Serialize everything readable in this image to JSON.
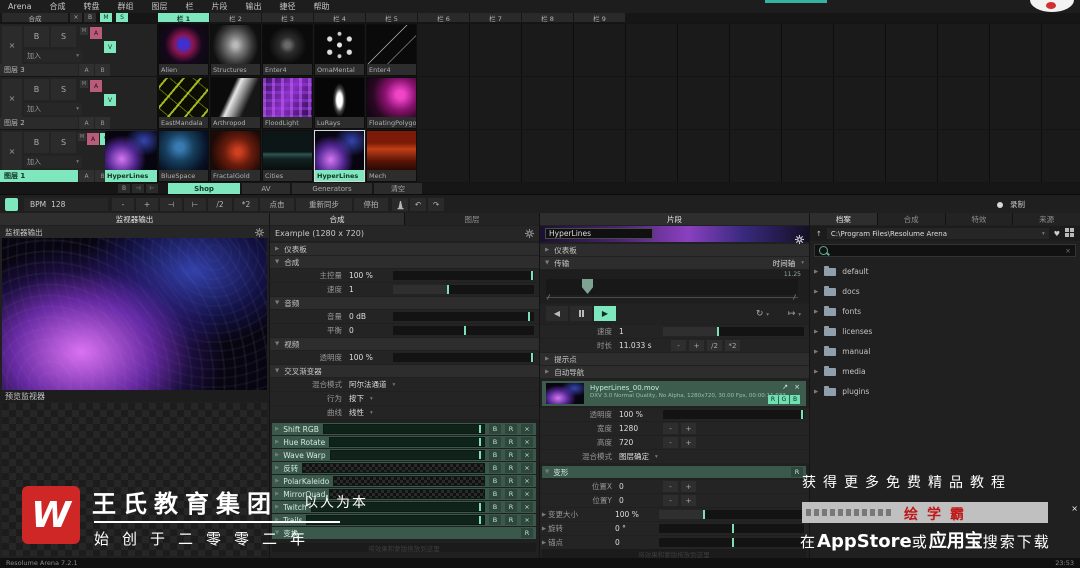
{
  "menu": [
    "Arena",
    "合成",
    "转盘",
    "群组",
    "图层",
    "栏",
    "片段",
    "输出",
    "捷径",
    "帮助"
  ],
  "glyphs": {
    "close": "×",
    "b": "B",
    "s": "S",
    "m": "M",
    "a": "A",
    "v": "V",
    "r": "R",
    "x_label": "X",
    "join": "加入",
    "caret": "▾",
    "tri_right": "▶",
    "tri_down": "▼",
    "minus": "-",
    "plus": "+",
    "half": "/2",
    "double": "*2",
    "rev": "◀",
    "play": "▶",
    "loop": "↻",
    "direction": "↦",
    "nudge_l": "⊣",
    "nudge_r": "⊢",
    "undo": "↶",
    "redo": "↷",
    "heart": "♥",
    "up": "↑",
    "expand": "↗"
  },
  "grid": {
    "comp_label": "合成",
    "columns": [
      "栏 1",
      "栏 2",
      "栏 3",
      "栏 4",
      "栏 5",
      "栏 6",
      "栏 7",
      "栏 8",
      "栏 9"
    ],
    "join_label": "加入",
    "layers": [
      {
        "name": "图层 3"
      },
      {
        "name": "图层 2"
      },
      {
        "name": "图层 1",
        "active_clip": "HyperLines"
      }
    ],
    "rows": [
      {
        "clips": [
          "Alien",
          "Structures",
          "Enter4",
          "OrnaMental",
          "Enter4"
        ]
      },
      {
        "clips": [
          "EastMandala",
          "Arthropod",
          "FloodLight",
          "LuRays",
          "FloatingPolygons"
        ]
      },
      {
        "clips": [
          "BlueSpace",
          "FractalGold",
          "Cities",
          "HyperLines",
          "Mech"
        ]
      }
    ]
  },
  "deck": {
    "tabs": [
      "Shop",
      "AV",
      "Generators",
      "清空"
    ]
  },
  "toolbar": {
    "bpm_label": "BPM",
    "bpm_value": "128",
    "tap": "点击",
    "resync": "重新同步",
    "pause": "停拍",
    "record": "录制"
  },
  "monitor": {
    "tab": "监视器输出",
    "title": "监视器输出",
    "preview_label": "预览监视器"
  },
  "comp_panel": {
    "tabs": [
      "合成",
      "图层"
    ],
    "title": "Example (1280 x 720)",
    "dashboard": "仪表板",
    "composition": "合成",
    "audio": "音频",
    "video": "视频",
    "crossfader": "交叉渐变器",
    "master": {
      "label": "主控量",
      "value": "100 %"
    },
    "speed": {
      "label": "速度",
      "value": "1"
    },
    "volume": {
      "label": "音量",
      "value": "0 dB"
    },
    "pan": {
      "label": "平衡",
      "value": "0"
    },
    "opacity": {
      "label": "透明度",
      "value": "100 %"
    },
    "blend": {
      "label": "混合模式",
      "value": "阿尔法通道"
    },
    "behaviour": {
      "label": "行为",
      "value": "按下"
    },
    "curve": {
      "label": "曲线",
      "value": "线性"
    },
    "hint": "将效果和蒙版拖放到这里"
  },
  "effects": {
    "list": [
      {
        "name": "Shift RGB"
      },
      {
        "name": "Hue Rotate"
      },
      {
        "name": "Wave Warp"
      },
      {
        "name": "反转"
      },
      {
        "name": "PolarKaleido"
      },
      {
        "name": "MirrorQuad"
      },
      {
        "name": "Twitch"
      },
      {
        "name": "Trails"
      },
      {
        "name": "变换"
      }
    ]
  },
  "clip_panel": {
    "tab": "片段",
    "name": "HyperLines",
    "dashboard": "仪表板",
    "transport": "传输",
    "transport_mode": "时间轴",
    "timeline_value": "11.25",
    "speed": {
      "label": "速度",
      "value": "1"
    },
    "duration": {
      "label": "时长",
      "value": "11.033 s"
    },
    "cuepoints": "提示点",
    "autopilot": "自动导航",
    "file": {
      "name": "HyperLines_00.mov",
      "info": "DXV 3.0 Normal Quality, No Alpha, 1280x720, 30.00 Fps, 00:00:11.033",
      "channels": [
        "R",
        "G",
        "B"
      ]
    },
    "opacity": {
      "label": "透明度",
      "value": "100 %"
    },
    "width": {
      "label": "宽度",
      "value": "1280"
    },
    "height": {
      "label": "高度",
      "value": "720"
    },
    "blend": {
      "label": "混合模式",
      "value": "图层确定"
    },
    "transform": "变形",
    "posx": {
      "label": "位置X",
      "value": "0"
    },
    "posy": {
      "label": "位置Y",
      "value": "0"
    },
    "scale": {
      "label": "变更大小",
      "value": "100 %"
    },
    "rotation": {
      "label": "旋转",
      "value": "0 °"
    },
    "anchor": {
      "label": "锚点",
      "value": "0"
    },
    "hint": "将效果和蒙版拖放到这里"
  },
  "browser": {
    "tabs": [
      "档案",
      "合成",
      "特效",
      "来源"
    ],
    "path": "C:\\Program Files\\Resolume Arena",
    "folders": [
      "default",
      "docs",
      "fonts",
      "licenses",
      "manual",
      "media",
      "plugins"
    ]
  },
  "statusbar": {
    "app": "Resolume Arena 7.2.1",
    "time": "23:53"
  },
  "watermark_left": {
    "logo": "W",
    "title": "王氏教育集团",
    "slogan": "以人为本",
    "line2": "始创于二零零二年"
  },
  "overlay_right": {
    "line1": "获得更多免费精品教程",
    "app_name": "绘学霸",
    "close": "×",
    "line2_prefix": "在",
    "line2_store": "AppStore",
    "line2_or": "或",
    "line2_store2": "应用宝",
    "line2_suffix": "搜索下载"
  },
  "colors": {
    "accent_green": "#7fe7bd",
    "pink": "#b85c7a",
    "effect_green": "#3b584c",
    "logo_red": "#cf2626",
    "app_red": "#c01818"
  }
}
